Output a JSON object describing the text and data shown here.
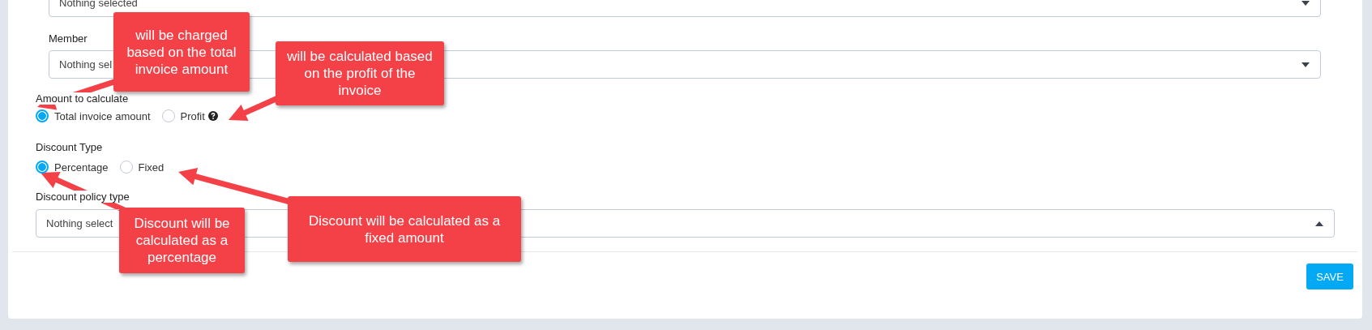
{
  "top_select": {
    "value": "Nothing selected",
    "expanded": false
  },
  "member": {
    "label": "Member",
    "value": "Nothing sel",
    "expanded": false
  },
  "amount": {
    "label": "Amount to calculate",
    "options": [
      {
        "label": "Total invoice amount",
        "selected": true,
        "help": false
      },
      {
        "label": "Profit",
        "selected": false,
        "help": true
      }
    ]
  },
  "discount_type": {
    "label": "Discount Type",
    "options": [
      {
        "label": "Percentage",
        "selected": true,
        "help": false
      },
      {
        "label": "Fixed",
        "selected": false,
        "help": false
      }
    ]
  },
  "policy": {
    "label": "Discount policy type",
    "value": "Nothing select",
    "expanded": true
  },
  "save_button": "SAVE",
  "callouts": [
    {
      "text": "will be charged based on the total invoice amount"
    },
    {
      "text": "will be calculated based on the profit of the invoice"
    },
    {
      "text": "Discount will be calculated as a percentage"
    },
    {
      "text": "Discount will be calculated as a fixed amount"
    }
  ]
}
